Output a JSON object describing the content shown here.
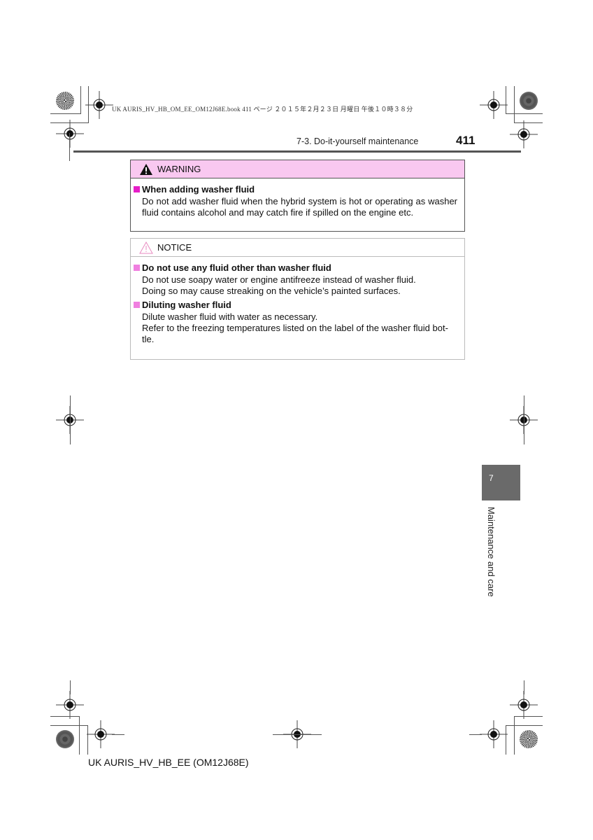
{
  "print_header": "UK AURIS_HV_HB_OM_EE_OM12J68E.book  411 ページ  ２０１５年２月２３日  月曜日  午後１０時３８分",
  "header": {
    "section_title": "7-3. Do-it-yourself maintenance",
    "page_number": "411"
  },
  "warning": {
    "icon": "warning-triangle-icon",
    "label": "WARNING",
    "items": [
      {
        "title": "When adding washer fluid",
        "text": "Do not add washer fluid when the hybrid system is hot or operating as washer fluid contains alcohol and may catch fire if spilled on the engine etc."
      }
    ]
  },
  "notice": {
    "icon": "notice-triangle-icon",
    "label": "NOTICE",
    "items": [
      {
        "title": "Do not use any fluid other than washer fluid",
        "lines": [
          "Do not use soapy water or engine antifreeze instead of washer fluid.",
          "Doing so may cause streaking on the vehicle’s painted surfaces."
        ]
      },
      {
        "title": "Diluting washer fluid",
        "lines": [
          "Dilute washer fluid with water as necessary.",
          "Refer to the freezing temperatures listed on the label of the washer fluid bot-tle."
        ]
      }
    ]
  },
  "chapter_tab": {
    "number": "7",
    "label": "Maintenance and care"
  },
  "footer": "UK AURIS_HV_HB_EE (OM12J68E)",
  "colors": {
    "warning_header_bg": "#f9c8f0",
    "bullet_magenta": "#e61ec8",
    "chapter_tab_bg": "#6a6a6a"
  }
}
